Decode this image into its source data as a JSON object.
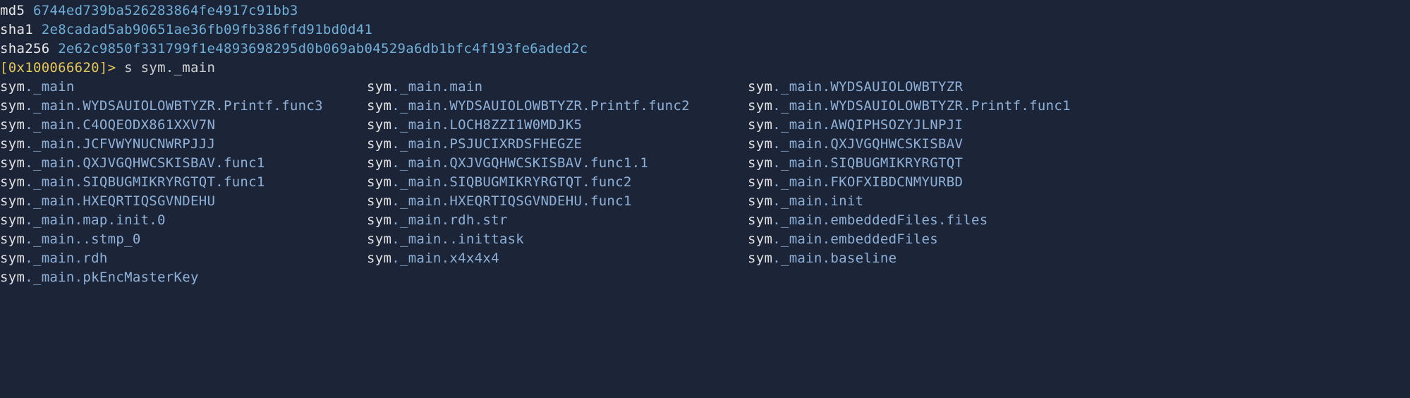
{
  "hashes": {
    "md5_label": "md5",
    "md5_value": "6744ed739ba526283864fe4917c91bb3",
    "sha1_label": "sha1",
    "sha1_value": "2e8cadad5ab90651ae36fb09fb386ffd91bd0d41",
    "sha256_label": "sha256",
    "sha256_value": "2e62c9850f331799f1e4893698295d0b069ab04529a6db1bfc4f193fe6aded2c"
  },
  "prompt": {
    "addr": "[0x100066620]",
    "arrow": ">",
    "cmd": "s sym._main"
  },
  "rows": [
    {
      "c0": "sym._main",
      "c1": "sym._main.main",
      "c2": "sym._main.WYDSAUIOLOWBTYZR"
    },
    {
      "c0": "sym._main.WYDSAUIOLOWBTYZR.Printf.func3",
      "c1": "sym._main.WYDSAUIOLOWBTYZR.Printf.func2",
      "c2": "sym._main.WYDSAUIOLOWBTYZR.Printf.func1"
    },
    {
      "c0": "sym._main.C4OQEODX861XXV7N",
      "c1": "sym._main.LOCH8ZZI1W0MDJK5",
      "c2": "sym._main.AWQIPHSOZYJLNPJI"
    },
    {
      "c0": "sym._main.JCFVWYNUCNWRPJJJ",
      "c1": "sym._main.PSJUCIXRDSFHEGZE",
      "c2": "sym._main.QXJVGQHWCSKISBAV"
    },
    {
      "c0": "sym._main.QXJVGQHWCSKISBAV.func1",
      "c1": "sym._main.QXJVGQHWCSKISBAV.func1.1",
      "c2": "sym._main.SIQBUGMIKRYRGTQT"
    },
    {
      "c0": "sym._main.SIQBUGMIKRYRGTQT.func1",
      "c1": "sym._main.SIQBUGMIKRYRGTQT.func2",
      "c2": "sym._main.FKOFXIBDCNMYURBD"
    },
    {
      "c0": "sym._main.HXEQRTIQSGVNDEHU",
      "c1": "sym._main.HXEQRTIQSGVNDEHU.func1",
      "c2": "sym._main.init"
    },
    {
      "c0": "sym._main.map.init.0",
      "c1": "sym._main.rdh.str",
      "c2": "sym._main.embeddedFiles.files"
    },
    {
      "c0": "sym._main..stmp_0",
      "c1": "sym._main..inittask",
      "c2": "sym._main.embeddedFiles"
    },
    {
      "c0": "sym._main.rdh",
      "c1": "sym._main.x4x4x4",
      "c2": "sym._main.baseline"
    },
    {
      "c0": "sym._main.pkEncMasterKey",
      "c1": "",
      "c2": ""
    }
  ]
}
